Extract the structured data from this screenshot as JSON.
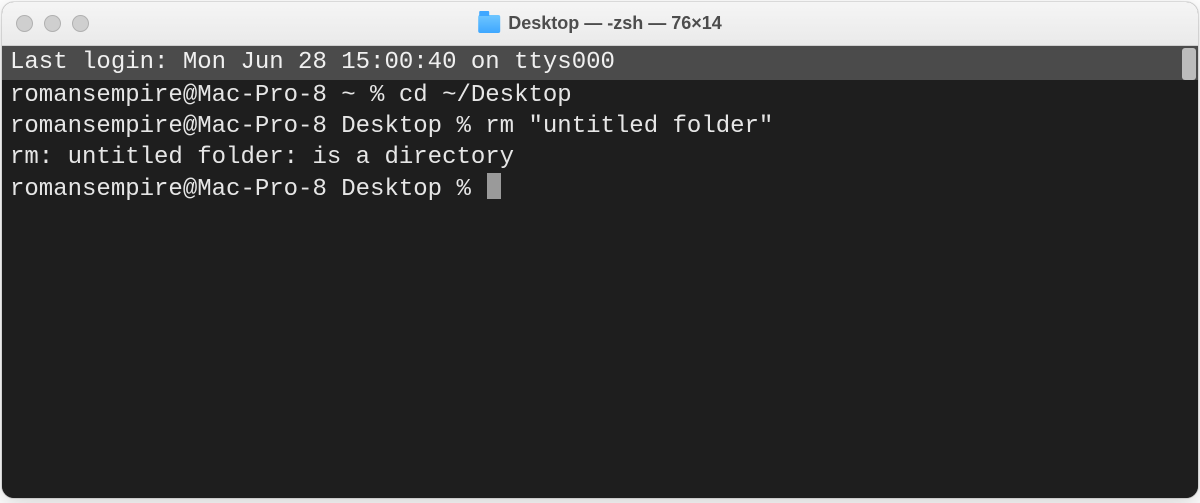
{
  "window": {
    "title": "Desktop — -zsh — 76×14"
  },
  "terminal": {
    "welcome": "Last login: Mon Jun 28 15:00:40 on ttys000",
    "lines": [
      "romansempire@Mac-Pro-8 ~ % cd ~/Desktop",
      "romansempire@Mac-Pro-8 Desktop % rm \"untitled folder\"",
      "rm: untitled folder: is a directory",
      "romansempire@Mac-Pro-8 Desktop % "
    ]
  }
}
